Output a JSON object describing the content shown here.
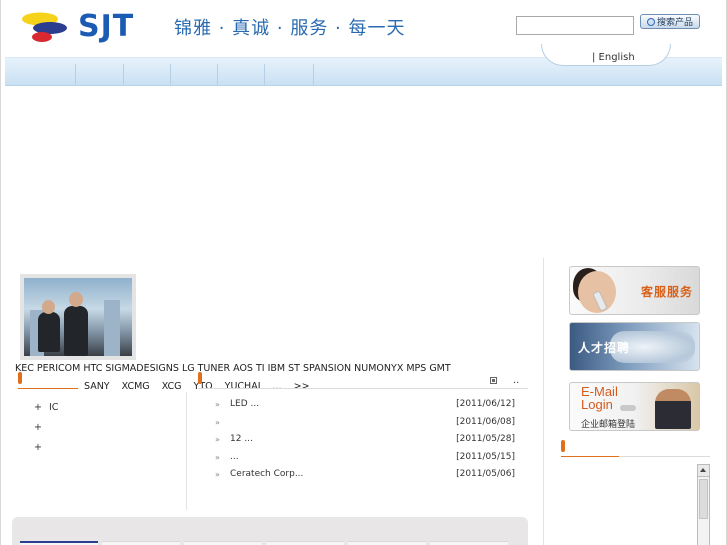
{
  "header": {
    "logo_text": "SJT",
    "slogan": "锦雅 · 真诚 · 服务 · 每一天",
    "search_placeholder": "",
    "search_button": "搜索产品",
    "lang_link": "| English"
  },
  "nav": {
    "items": [
      "",
      "",
      "",
      "",
      "",
      ""
    ]
  },
  "brands": {
    "row1": "KEC PERICOM HTC SIGMADESIGNS LG TUNER  AOS TI IBM ST SPANSION NUMONYX MPS GMT",
    "row2": [
      "SANY",
      "XCMG",
      "XCG",
      "YTO",
      "YUCHAI",
      "...",
      ">>"
    ]
  },
  "products": {
    "items": [
      {
        "prefix": "+",
        "label": "IC"
      },
      {
        "prefix": "+",
        "label": ""
      },
      {
        "prefix": "+",
        "label": ""
      }
    ]
  },
  "more_label": "..",
  "news": [
    {
      "bullet": "»",
      "title": "LED          ...",
      "date": "[2011/06/12]"
    },
    {
      "bullet": "»",
      "title": "",
      "date": "[2011/06/08]"
    },
    {
      "bullet": "»",
      "title": "       12      ...",
      "date": "[2011/05/28]"
    },
    {
      "bullet": "»",
      "title": "                  ...",
      "date": "[2011/05/15]"
    },
    {
      "bullet": "»",
      "title": "   Ceratech Corp...",
      "date": "[2011/05/06]"
    }
  ],
  "banners": {
    "service": "客服服务",
    "jobs": "人才招聘",
    "email_title": "E-Mail",
    "email_login": "Login",
    "email_sub": "企业邮箱登陆"
  },
  "colors": {
    "accent": "#e0701b",
    "brand": "#1b5bb3",
    "nav": "#c9e0f3"
  }
}
